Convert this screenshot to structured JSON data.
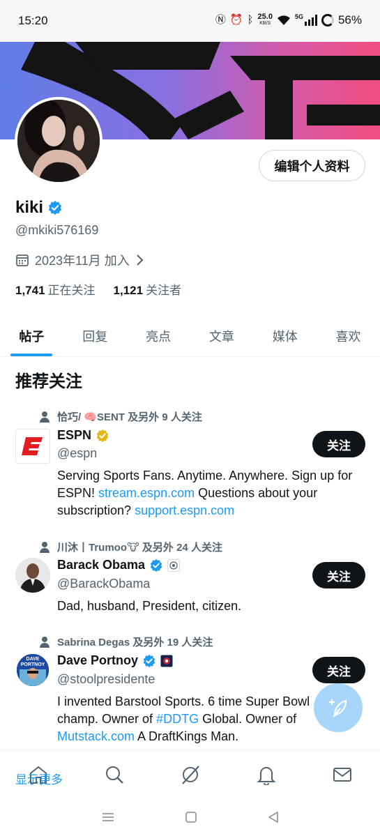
{
  "status_bar": {
    "time": "15:20",
    "net_speed": "25.0",
    "net_unit": "KB/S",
    "network": "5G",
    "battery": "56%"
  },
  "profile": {
    "edit_button": "编辑个人资料",
    "name": "kiki",
    "handle": "@mkiki576169",
    "joined": "2023年11月 加入",
    "following_count": "1,741",
    "following_label": "正在关注",
    "followers_count": "1,121",
    "followers_label": "关注者"
  },
  "tabs": [
    "帖子",
    "回复",
    "亮点",
    "文章",
    "媒体",
    "喜欢"
  ],
  "section_title": "推荐关注",
  "suggestions": [
    {
      "social": "恰巧/ 🧠SENT 及另外 9 人关注",
      "name": "ESPN",
      "handle": "@espn",
      "bio_1": "Serving Sports Fans. Anytime. Anywhere. Sign up for ESPN! ",
      "link_1": "stream.espn.com",
      "bio_2": " Questions about your subscription? ",
      "link_2": "support.espn.com",
      "follow": "关注",
      "badge_color": "#e2b719"
    },
    {
      "social": "川沐丨Trumoo🐮 及另外 24 人关注",
      "name": "Barack Obama",
      "handle": "@BarackObama",
      "bio_1": "Dad, husband, President, citizen.",
      "follow": "关注",
      "badge_color": "#1d9bf0"
    },
    {
      "social": "Sabrina Degas 及另外 19 人关注",
      "name": "Dave Portnoy",
      "handle": "@stoolpresidente",
      "bio_1": "I invented Barstool Sports. 6 time Super Bowl champ. Owner of ",
      "link_1": "#DDTG",
      "bio_2": " Global. Owner of ",
      "link_2": "Mutstack.com",
      "bio_3": " A DraftKings Man.",
      "avatar_text": "DAVE PORTNOY",
      "follow": "关注",
      "badge_color": "#1d9bf0"
    }
  ],
  "show_more": "显示更多",
  "bottom_nav": [
    "home-icon",
    "search-icon",
    "grok-icon",
    "notifications-icon",
    "messages-icon"
  ],
  "colors": {
    "accent": "#1d9bf0",
    "text": "#0f1419",
    "muted": "#536471"
  }
}
